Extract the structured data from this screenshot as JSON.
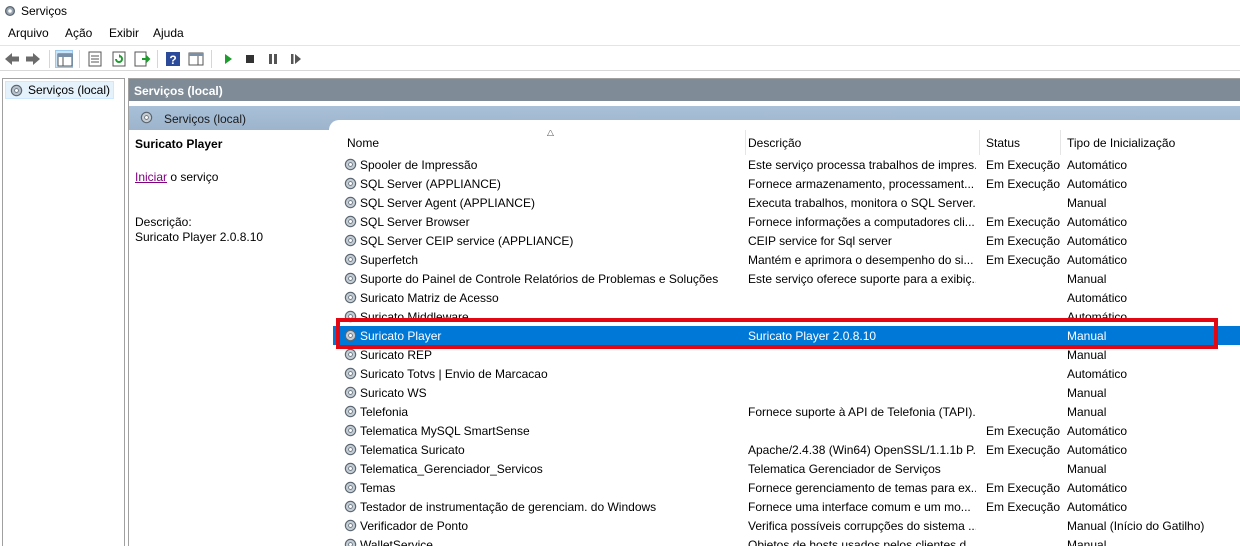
{
  "window": {
    "title": "Serviços",
    "icon": "services-gear-icon"
  },
  "menu": [
    "Arquivo",
    "Ação",
    "Exibir",
    "Ajuda"
  ],
  "toolbar": {
    "buttons": [
      "back-icon",
      "forward-icon",
      "show-hide-console-tree-icon",
      "properties-icon",
      "refresh-icon",
      "export-list-icon",
      "help-icon",
      "show-hide-action-pane-icon",
      "start-service-icon",
      "stop-service-icon",
      "pause-service-icon",
      "resume-service-icon"
    ]
  },
  "tree": {
    "root": "Serviços (local)"
  },
  "pane": {
    "header": "Serviços (local)",
    "subheader": "Serviços (local)"
  },
  "details": {
    "service_name": "Suricato Player",
    "start_link": "Iniciar",
    "start_suffix": " o serviço",
    "description_label": "Descrição:",
    "description_value": "Suricato Player 2.0.8.10"
  },
  "columns": [
    "Nome",
    "Descrição",
    "Status",
    "Tipo de Inicialização"
  ],
  "selected_row_index": 9,
  "colors": {
    "selection": "#0078d7",
    "highlight_box": "#e30613",
    "header": "#7f8b97"
  },
  "services": [
    {
      "name": "Spooler de Impressão",
      "description": "Este serviço processa trabalhos de impres...",
      "status": "Em Execução",
      "startup": "Automático"
    },
    {
      "name": "SQL Server (APPLIANCE)",
      "description": "Fornece armazenamento, processament...",
      "status": "Em Execução",
      "startup": "Automático"
    },
    {
      "name": "SQL Server Agent (APPLIANCE)",
      "description": "Executa trabalhos, monitora o SQL Server...",
      "status": "",
      "startup": "Manual"
    },
    {
      "name": "SQL Server Browser",
      "description": "Fornece informações a computadores cli...",
      "status": "Em Execução",
      "startup": "Automático"
    },
    {
      "name": "SQL Server CEIP service (APPLIANCE)",
      "description": "CEIP service for Sql server",
      "status": "Em Execução",
      "startup": "Automático"
    },
    {
      "name": "Superfetch",
      "description": "Mantém e aprimora o desempenho do si...",
      "status": "Em Execução",
      "startup": "Automático"
    },
    {
      "name": "Suporte do Painel de Controle Relatórios de Problemas e Soluções",
      "description": "Este serviço oferece suporte para a exibiç...",
      "status": "",
      "startup": "Manual"
    },
    {
      "name": "Suricato Matriz de Acesso",
      "description": "",
      "status": "",
      "startup": "Automático"
    },
    {
      "name": "Suricato Middleware",
      "description": "",
      "status": "",
      "startup": "Automático"
    },
    {
      "name": "Suricato Player",
      "description": "Suricato Player 2.0.8.10",
      "status": "",
      "startup": "Manual"
    },
    {
      "name": "Suricato REP",
      "description": "",
      "status": "",
      "startup": "Manual"
    },
    {
      "name": "Suricato Totvs | Envio de Marcacao",
      "description": "",
      "status": "",
      "startup": "Automático"
    },
    {
      "name": "Suricato WS",
      "description": "",
      "status": "",
      "startup": "Manual"
    },
    {
      "name": "Telefonia",
      "description": "Fornece suporte à API de Telefonia (TAPI)...",
      "status": "",
      "startup": "Manual"
    },
    {
      "name": "Telematica MySQL SmartSense",
      "description": "",
      "status": "Em Execução",
      "startup": "Automático"
    },
    {
      "name": "Telematica Suricato",
      "description": "Apache/2.4.38 (Win64) OpenSSL/1.1.1b P...",
      "status": "Em Execução",
      "startup": "Automático"
    },
    {
      "name": "Telematica_Gerenciador_Servicos",
      "description": "Telematica Gerenciador de Serviços",
      "status": "",
      "startup": "Manual"
    },
    {
      "name": "Temas",
      "description": "Fornece gerenciamento de temas para ex...",
      "status": "Em Execução",
      "startup": "Automático"
    },
    {
      "name": "Testador de instrumentação de gerenciam. do Windows",
      "description": "Fornece uma interface comum e um mo...",
      "status": "Em Execução",
      "startup": "Automático"
    },
    {
      "name": "Verificador de Ponto",
      "description": "Verifica possíveis corrupções do sistema ...",
      "status": "",
      "startup": "Manual (Início do Gatilho)"
    },
    {
      "name": "WalletService",
      "description": "Objetos de hosts usados pelos clientes d...",
      "status": "",
      "startup": "Manual"
    }
  ]
}
